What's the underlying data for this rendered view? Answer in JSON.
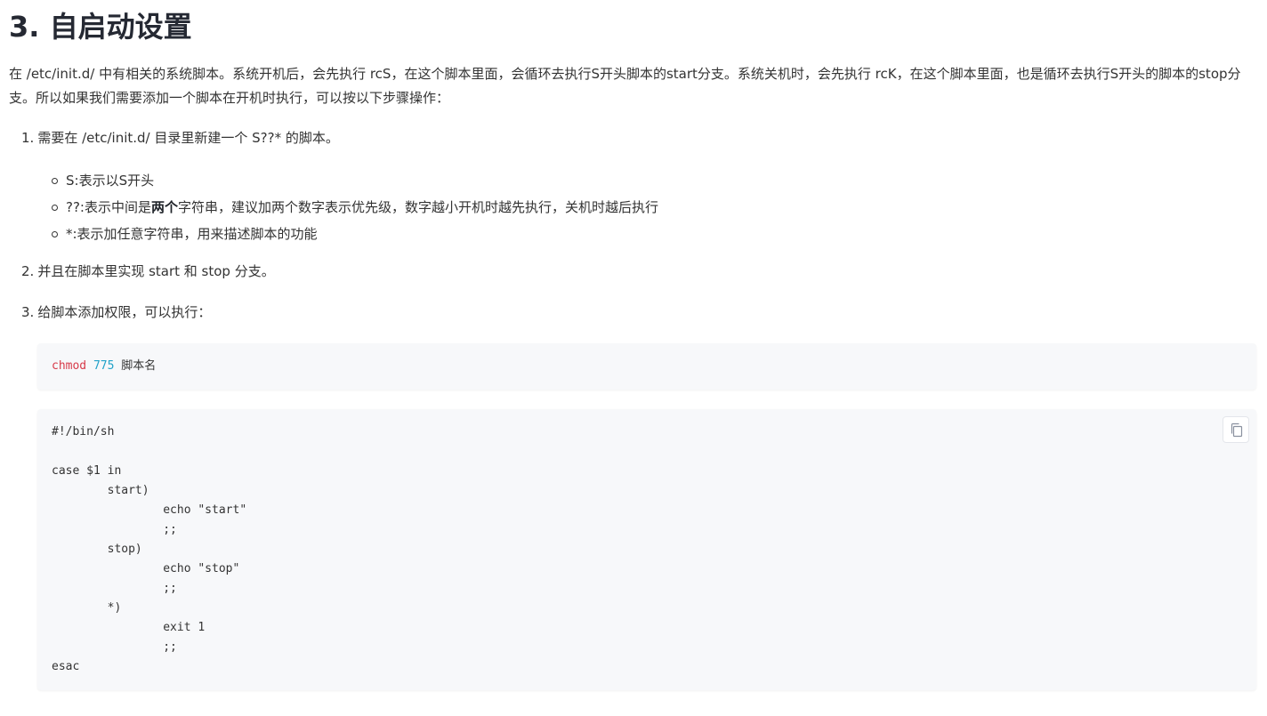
{
  "section_title": "3. 自启动设置",
  "intro": "在 /etc/init.d/ 中有相关的系统脚本。系统开机后，会先执行 rcS，在这个脚本里面，会循环去执行S开头脚本的start分支。系统关机时，会先执行 rcK，在这个脚本里面，也是循环去执行S开头的脚本的stop分支。所以如果我们需要添加一个脚本在开机时执行，可以按以下步骤操作：",
  "steps": [
    {
      "num": "1.",
      "text": "需要在 /etc/init.d/ 目录里新建一个 S??* 的脚本。"
    },
    {
      "num": "2.",
      "text": "并且在脚本里实现 start 和 stop 分支。"
    },
    {
      "num": "3.",
      "text": "给脚本添加权限，可以执行："
    }
  ],
  "bullets": [
    {
      "text": "S:表示以S开头"
    },
    {
      "pre": "??:表示中间是",
      "bold": "两个",
      "post": "字符串，建议加两个数字表示优先级，数字越小开机时越先执行，关机时越后执行"
    },
    {
      "text": "*:表示加任意字符串，用来描述脚本的功能"
    }
  ],
  "code_chmod": {
    "cmd": "chmod",
    "mode": "775",
    "arg": "脚本名"
  },
  "code_script": [
    "#!/bin/sh",
    "",
    "case $1 in",
    "        start)",
    "                echo \"start\"",
    "                ;;",
    "        stop)",
    "                echo \"stop\"",
    "                ;;",
    "        *)",
    "                exit 1",
    "                ;;",
    "esac"
  ],
  "icons": {
    "copy": "copy-icon"
  }
}
